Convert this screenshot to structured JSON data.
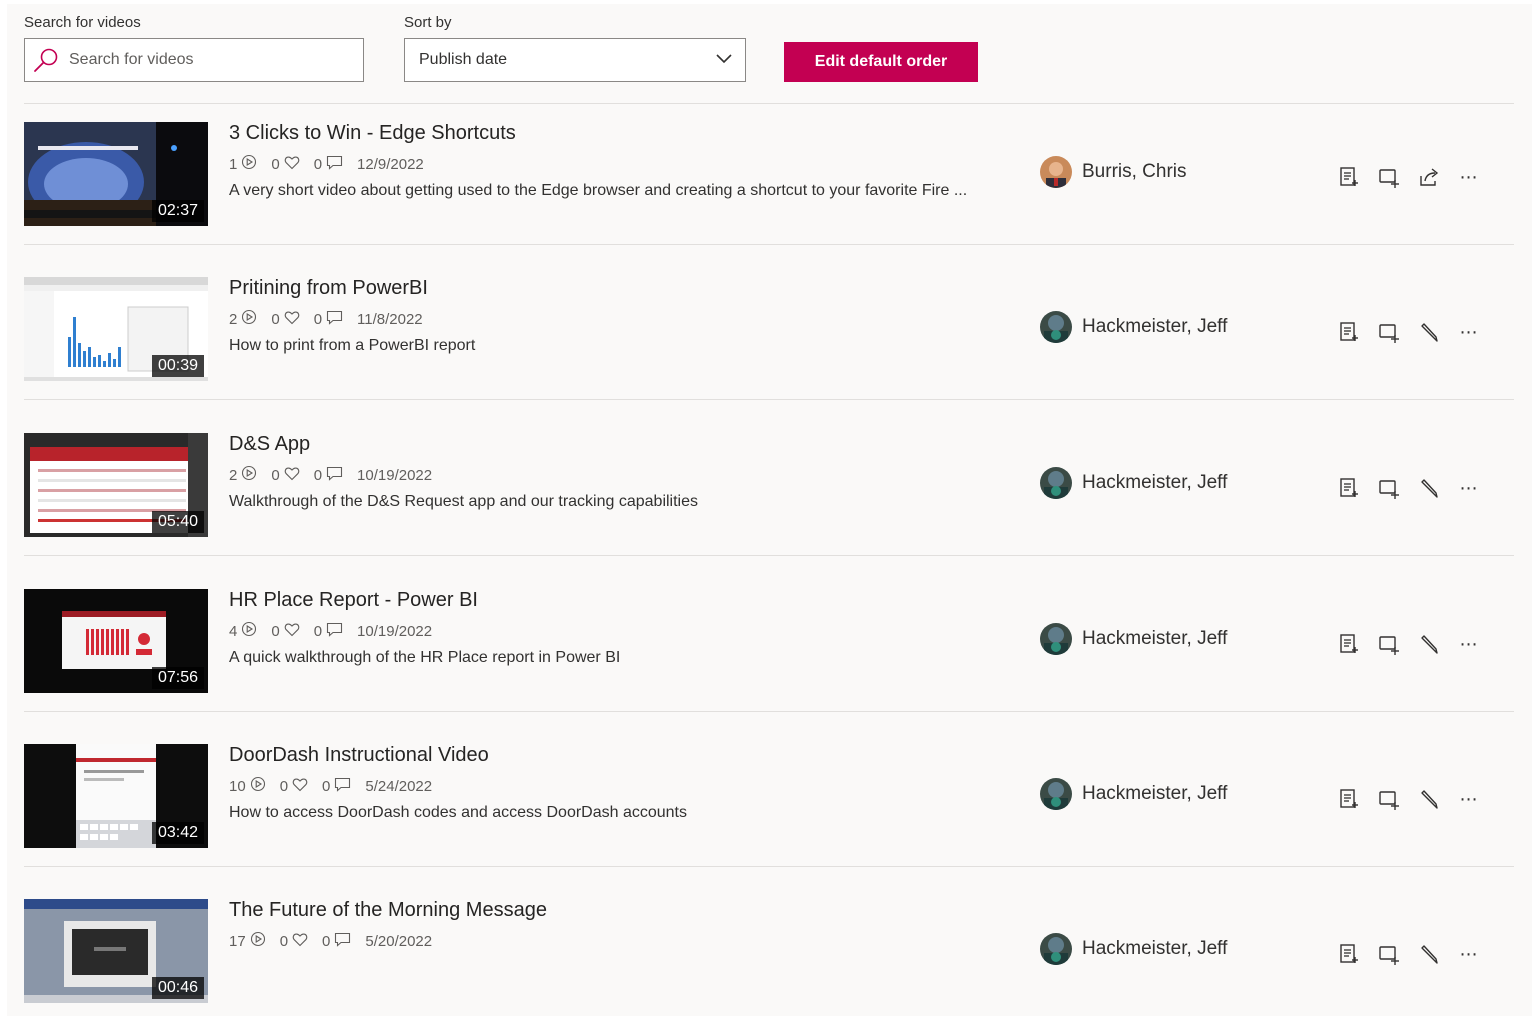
{
  "controls": {
    "search_label": "Search for videos",
    "search_placeholder": "Search for videos",
    "sort_label": "Sort by",
    "sort_value": "Publish date",
    "edit_button": "Edit default order"
  },
  "colors": {
    "accent": "#c30052",
    "background": "#faf9f8",
    "divider": "#e1dfdd"
  },
  "videos": [
    {
      "title": "3 Clicks to Win - Edge Shortcuts",
      "views": "1",
      "likes": "0",
      "comments": "0",
      "date": "12/9/2022",
      "description": "A very short video about getting used to the Edge browser and creating a shortcut to your favorite Fire ...",
      "duration": "02:37",
      "owner": "Burris, Chris",
      "actions": [
        "chapters-icon",
        "add-to-playlist-icon",
        "share-icon",
        "more-icon"
      ]
    },
    {
      "title": "Pritining from PowerBI",
      "views": "2",
      "likes": "0",
      "comments": "0",
      "date": "11/8/2022",
      "description": "How to print from a PowerBI report",
      "duration": "00:39",
      "owner": "Hackmeister, Jeff",
      "actions": [
        "chapters-icon",
        "add-to-playlist-icon",
        "edit-icon",
        "more-icon"
      ]
    },
    {
      "title": "D&S App",
      "views": "2",
      "likes": "0",
      "comments": "0",
      "date": "10/19/2022",
      "description": "Walkthrough of the D&S Request app and our tracking capabilities",
      "duration": "05:40",
      "owner": "Hackmeister, Jeff",
      "actions": [
        "chapters-icon",
        "add-to-playlist-icon",
        "edit-icon",
        "more-icon"
      ]
    },
    {
      "title": "HR Place Report - Power BI",
      "views": "4",
      "likes": "0",
      "comments": "0",
      "date": "10/19/2022",
      "description": "A quick walkthrough of the HR Place report in Power BI",
      "duration": "07:56",
      "owner": "Hackmeister, Jeff",
      "actions": [
        "chapters-icon",
        "add-to-playlist-icon",
        "edit-icon",
        "more-icon"
      ]
    },
    {
      "title": "DoorDash Instructional Video",
      "views": "10",
      "likes": "0",
      "comments": "0",
      "date": "5/24/2022",
      "description": "How to access DoorDash codes and access DoorDash accounts",
      "duration": "03:42",
      "owner": "Hackmeister, Jeff",
      "actions": [
        "chapters-icon",
        "add-to-playlist-icon",
        "edit-icon",
        "more-icon"
      ]
    },
    {
      "title": "The Future of the Morning Message",
      "views": "17",
      "likes": "0",
      "comments": "0",
      "date": "5/20/2022",
      "description": "",
      "duration": "00:46",
      "owner": "Hackmeister, Jeff",
      "actions": [
        "chapters-icon",
        "add-to-playlist-icon",
        "edit-icon",
        "more-icon"
      ]
    }
  ]
}
